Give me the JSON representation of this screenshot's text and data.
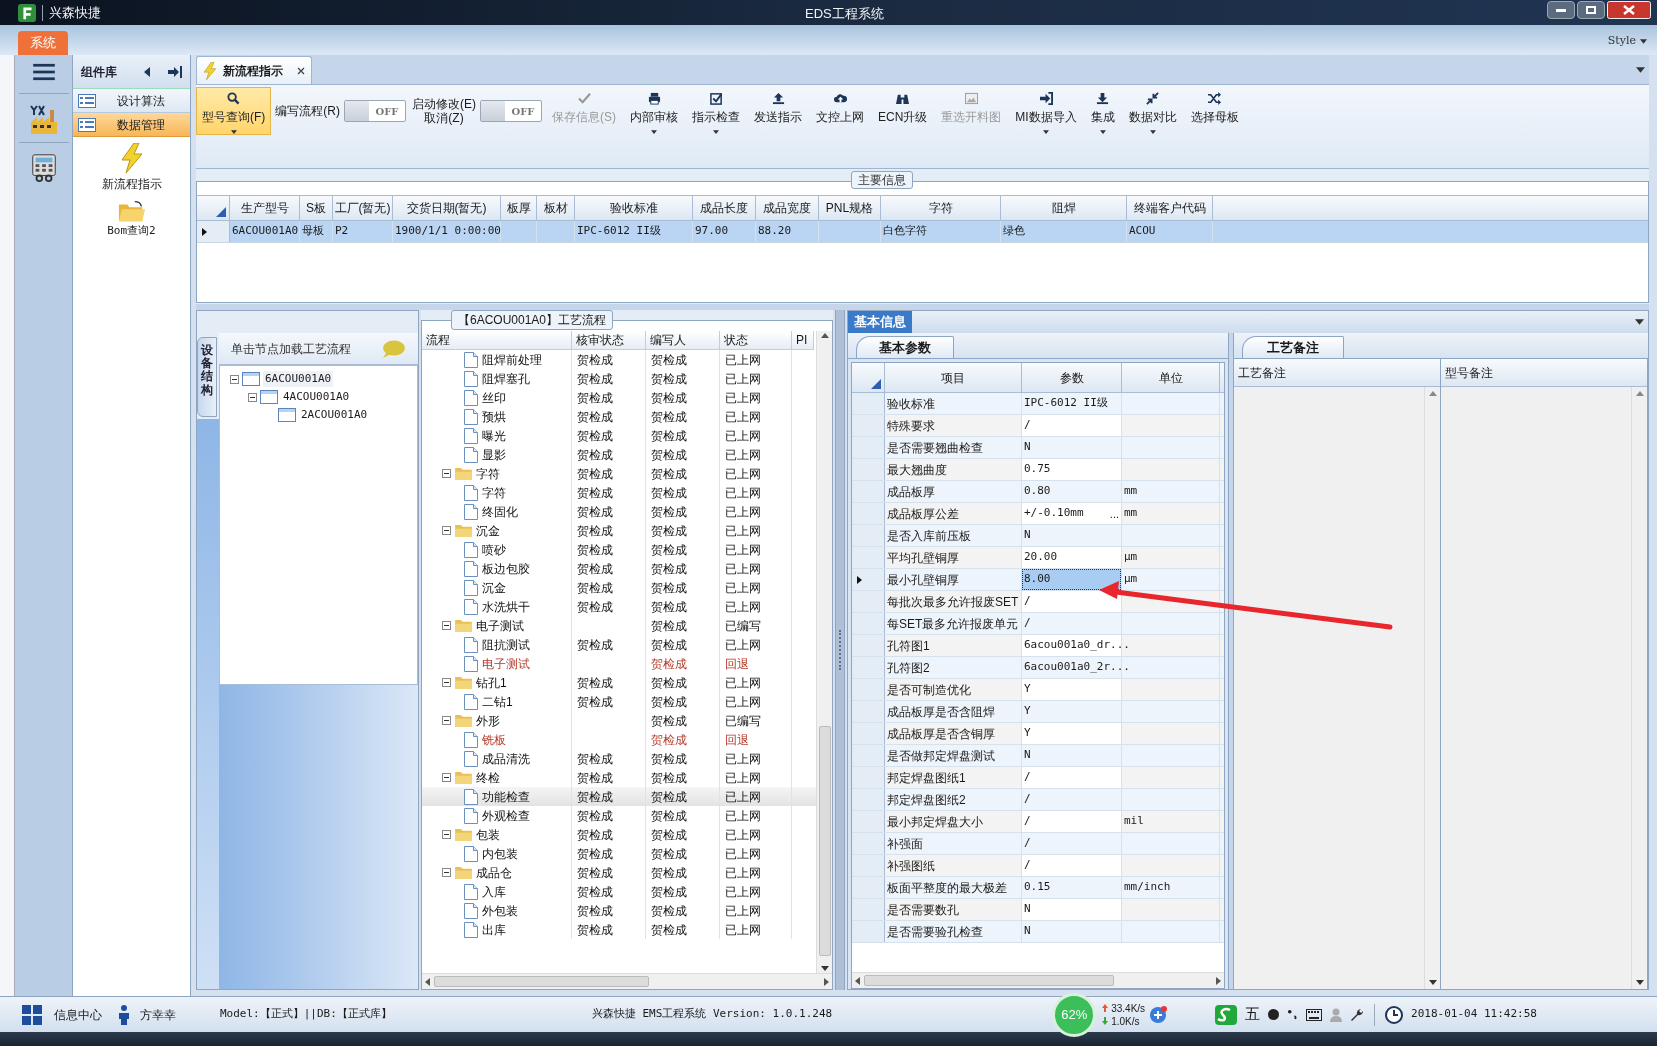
{
  "window": {
    "app_name": "兴森快捷",
    "title": "EDS工程系统"
  },
  "ribbon": {
    "tabs": [
      {
        "label": "系统",
        "selected": true
      }
    ],
    "style_button": "Style"
  },
  "component_panel": {
    "title": "组件库",
    "items": [
      {
        "label": "设计算法",
        "selected": false
      },
      {
        "label": "数据管理",
        "selected": true
      }
    ],
    "launchers": [
      {
        "label": "新流程指示"
      },
      {
        "label": "Bom查询2"
      }
    ]
  },
  "doc_tabs": [
    {
      "label": "新流程指示",
      "selected": true
    }
  ],
  "toolbar": [
    {
      "kind": "button",
      "label": "型号查询(F)",
      "dropdown": true,
      "disabled": false,
      "selected": true
    },
    {
      "kind": "toggle",
      "label_lines": [
        "编写流程(R)"
      ],
      "switch_text": "OFF",
      "on": false
    },
    {
      "kind": "toggle",
      "label_lines": [
        "启动修改(E)",
        "取消(Z)"
      ],
      "switch_text": "OFF",
      "on": false
    },
    {
      "kind": "button",
      "label": "保存信息(S)",
      "dropdown": false,
      "disabled": true,
      "selected": false
    },
    {
      "kind": "button",
      "label": "内部审核",
      "dropdown": true,
      "disabled": false,
      "selected": false
    },
    {
      "kind": "button",
      "label": "指示检查",
      "dropdown": true,
      "disabled": false,
      "selected": false
    },
    {
      "kind": "button",
      "label": "发送指示",
      "dropdown": false,
      "disabled": false,
      "selected": false
    },
    {
      "kind": "button",
      "label": "文控上网",
      "dropdown": false,
      "disabled": false,
      "selected": false
    },
    {
      "kind": "button",
      "label": "ECN升级",
      "dropdown": false,
      "disabled": false,
      "selected": false
    },
    {
      "kind": "button",
      "label": "重选开料图",
      "dropdown": false,
      "disabled": true,
      "selected": false
    },
    {
      "kind": "button",
      "label": "MI数据导入",
      "dropdown": true,
      "disabled": false,
      "selected": false
    },
    {
      "kind": "button",
      "label": "集成",
      "dropdown": true,
      "disabled": false,
      "selected": false
    },
    {
      "kind": "button",
      "label": "数据对比",
      "dropdown": true,
      "disabled": false,
      "selected": false
    },
    {
      "kind": "button",
      "label": "选择母板",
      "dropdown": false,
      "disabled": false,
      "selected": false
    }
  ],
  "main_info": {
    "title": "主要信息",
    "columns": [
      "生产型号",
      "S板",
      "工厂(暂无)",
      "交货日期(暂无)",
      "板厚",
      "板材",
      "验收标准",
      "成品长度",
      "成品宽度",
      "PNL规格",
      "字符",
      "阻焊",
      "终端客户代码"
    ],
    "rows": [
      {
        "selected": true,
        "cells": [
          "6ACOU001A0",
          "母板",
          "P2",
          "1900/1/1 0:00:00",
          null,
          null,
          "IPC-6012 II级",
          "97.00",
          "88.20",
          null,
          "白色字符",
          "绿色",
          "ACOU"
        ]
      }
    ]
  },
  "structure_panel": {
    "side_tab": "设备结构",
    "hint": "单击节点加载工艺流程",
    "tree": [
      {
        "label": "6ACOU001A0",
        "expanded": true,
        "children": [
          {
            "label": "4ACOU001A0",
            "expanded": true,
            "children": [
              {
                "label": "2ACOU001A0"
              }
            ]
          }
        ]
      }
    ]
  },
  "flow_panel": {
    "title": "【6ACOU001A0】工艺流程",
    "columns": [
      "流程",
      "核审状态",
      "编写人",
      "状态",
      "PI"
    ],
    "rows": [
      {
        "kind": "offscreen",
        "children": [
          {
            "kind": "file",
            "name": "阻焊前处理",
            "review": "贺检成",
            "writer": "贺检成",
            "state": "已上网",
            "flagged": false,
            "selected": false
          },
          {
            "kind": "file",
            "name": "阻焊塞孔",
            "review": "贺检成",
            "writer": "贺检成",
            "state": "已上网",
            "flagged": false,
            "selected": false
          },
          {
            "kind": "file",
            "name": "丝印",
            "review": "贺检成",
            "writer": "贺检成",
            "state": "已上网",
            "flagged": false,
            "selected": false
          },
          {
            "kind": "file",
            "name": "预烘",
            "review": "贺检成",
            "writer": "贺检成",
            "state": "已上网",
            "flagged": false,
            "selected": false
          },
          {
            "kind": "file",
            "name": "曝光",
            "review": "贺检成",
            "writer": "贺检成",
            "state": "已上网",
            "flagged": false,
            "selected": false
          },
          {
            "kind": "file",
            "name": "显影",
            "review": "贺检成",
            "writer": "贺检成",
            "state": "已上网",
            "flagged": false,
            "selected": false
          }
        ]
      },
      {
        "kind": "folder",
        "name": "字符",
        "review": "贺检成",
        "writer": "贺检成",
        "state": "已上网",
        "expanded": true,
        "flagged": false,
        "selected": false,
        "children": [
          {
            "kind": "file",
            "name": "字符",
            "review": "贺检成",
            "writer": "贺检成",
            "state": "已上网",
            "flagged": false,
            "selected": false
          },
          {
            "kind": "file",
            "name": "终固化",
            "review": "贺检成",
            "writer": "贺检成",
            "state": "已上网",
            "flagged": false,
            "selected": false
          }
        ]
      },
      {
        "kind": "folder",
        "name": "沉金",
        "review": "贺检成",
        "writer": "贺检成",
        "state": "已上网",
        "expanded": true,
        "flagged": false,
        "selected": false,
        "children": [
          {
            "kind": "file",
            "name": "喷砂",
            "review": "贺检成",
            "writer": "贺检成",
            "state": "已上网",
            "flagged": false,
            "selected": false
          },
          {
            "kind": "file",
            "name": "板边包胶",
            "review": "贺检成",
            "writer": "贺检成",
            "state": "已上网",
            "flagged": false,
            "selected": false
          },
          {
            "kind": "file",
            "name": "沉金",
            "review": "贺检成",
            "writer": "贺检成",
            "state": "已上网",
            "flagged": false,
            "selected": false
          },
          {
            "kind": "file",
            "name": "水洗烘干",
            "review": "贺检成",
            "writer": "贺检成",
            "state": "已上网",
            "flagged": false,
            "selected": false
          }
        ]
      },
      {
        "kind": "folder",
        "name": "电子测试",
        "writer": "贺检成",
        "state": "已编写",
        "expanded": true,
        "flagged": false,
        "selected": false,
        "children": [
          {
            "kind": "file",
            "name": "阻抗测试",
            "review": "贺检成",
            "writer": "贺检成",
            "state": "已上网",
            "flagged": false,
            "selected": false
          },
          {
            "kind": "file",
            "name": "电子测试",
            "writer": "贺检成",
            "state": "回退",
            "flagged": true,
            "selected": false
          }
        ]
      },
      {
        "kind": "folder",
        "name": "钻孔1",
        "review": "贺检成",
        "writer": "贺检成",
        "state": "已上网",
        "expanded": true,
        "flagged": false,
        "selected": false,
        "children": [
          {
            "kind": "file",
            "name": "二钻1",
            "review": "贺检成",
            "writer": "贺检成",
            "state": "已上网",
            "flagged": false,
            "selected": false
          }
        ]
      },
      {
        "kind": "folder",
        "name": "外形",
        "writer": "贺检成",
        "state": "已编写",
        "expanded": true,
        "flagged": false,
        "selected": false,
        "children": [
          {
            "kind": "file",
            "name": "铣板",
            "writer": "贺检成",
            "state": "回退",
            "flagged": true,
            "selected": false
          },
          {
            "kind": "file",
            "name": "成品清洗",
            "review": "贺检成",
            "writer": "贺检成",
            "state": "已上网",
            "flagged": false,
            "selected": false
          }
        ]
      },
      {
        "kind": "folder",
        "name": "终检",
        "review": "贺检成",
        "writer": "贺检成",
        "state": "已上网",
        "expanded": true,
        "flagged": false,
        "selected": false,
        "children": [
          {
            "kind": "file",
            "name": "功能检查",
            "review": "贺检成",
            "writer": "贺检成",
            "state": "已上网",
            "flagged": false,
            "selected": true
          },
          {
            "kind": "file",
            "name": "外观检查",
            "review": "贺检成",
            "writer": "贺检成",
            "state": "已上网",
            "flagged": false,
            "selected": false
          }
        ]
      },
      {
        "kind": "folder",
        "name": "包装",
        "review": "贺检成",
        "writer": "贺检成",
        "state": "已上网",
        "expanded": true,
        "flagged": false,
        "selected": false,
        "children": [
          {
            "kind": "file",
            "name": "内包装",
            "review": "贺检成",
            "writer": "贺检成",
            "state": "已上网",
            "flagged": false,
            "selected": false
          }
        ]
      },
      {
        "kind": "folder",
        "name": "成品仓",
        "review": "贺检成",
        "writer": "贺检成",
        "state": "已上网",
        "expanded": true,
        "flagged": false,
        "selected": false,
        "children": [
          {
            "kind": "file",
            "name": "入库",
            "review": "贺检成",
            "writer": "贺检成",
            "state": "已上网",
            "flagged": false,
            "selected": false
          },
          {
            "kind": "file",
            "name": "外包装",
            "review": "贺检成",
            "writer": "贺检成",
            "state": "已上网",
            "flagged": false,
            "selected": false
          },
          {
            "kind": "file",
            "name": "出库",
            "review": "贺检成",
            "writer": "贺检成",
            "state": "已上网",
            "flagged": false,
            "selected": false
          }
        ]
      }
    ]
  },
  "info_panel": {
    "title": "基本信息",
    "params_tab": "基本参数",
    "param_columns": [
      "项目",
      "参数",
      "单位"
    ],
    "params": [
      {
        "item": "验收标准",
        "value": "IPC-6012 II级",
        "selected": false
      },
      {
        "item": "特殊要求",
        "value": "/",
        "selected": false
      },
      {
        "item": "是否需要翘曲检查",
        "value": "N",
        "selected": false
      },
      {
        "item": "最大翘曲度",
        "value": "0.75",
        "selected": false
      },
      {
        "item": "成品板厚",
        "value": "0.80",
        "unit": "mm",
        "selected": false
      },
      {
        "item": "成品板厚公差",
        "value": "+/-0.10mm",
        "more": "...",
        "unit": "mm",
        "selected": false
      },
      {
        "item": "是否入库前压板",
        "value": "N",
        "selected": false
      },
      {
        "item": "平均孔壁铜厚",
        "value": "20.00",
        "unit": "μm",
        "selected": false
      },
      {
        "item": "最小孔壁铜厚",
        "value": "8.00",
        "unit": "μm",
        "selected": true
      },
      {
        "item": "每批次最多允许报废SET",
        "value": "/",
        "selected": false
      },
      {
        "item": "每SET最多允许报废单元",
        "value": "/",
        "selected": false
      },
      {
        "item": "孔符图1",
        "value": "6acou001a0_dr...",
        "selected": false
      },
      {
        "item": "孔符图2",
        "value": "6acou001a0_2r...",
        "selected": false
      },
      {
        "item": "是否可制造优化",
        "value": "Y",
        "selected": false
      },
      {
        "item": "成品板厚是否含阻焊",
        "value": "Y",
        "selected": false
      },
      {
        "item": "成品板厚是否含铜厚",
        "value": "Y",
        "selected": false
      },
      {
        "item": "是否做邦定焊盘测试",
        "value": "N",
        "selected": false
      },
      {
        "item": "邦定焊盘图纸1",
        "value": "/",
        "selected": false
      },
      {
        "item": "邦定焊盘图纸2",
        "value": "/",
        "selected": false
      },
      {
        "item": "最小邦定焊盘大小",
        "value": "/",
        "unit": "mil",
        "selected": false
      },
      {
        "item": "补强面",
        "value": "/",
        "selected": false
      },
      {
        "item": "补强图纸",
        "value": "/",
        "selected": false
      },
      {
        "item": "板面平整度的最大极差",
        "value": "0.15",
        "unit": "mm/inch",
        "selected": false
      },
      {
        "item": "是否需要数孔",
        "value": "N",
        "selected": false
      },
      {
        "item": "是否需要验孔检查",
        "value": "N",
        "selected": false
      }
    ],
    "remarks_tab": "工艺备注",
    "remark_columns": [
      "工艺备注",
      "型号备注"
    ]
  },
  "status_bar": {
    "message_center": "信息中心",
    "user": "方幸幸",
    "model": "Model:【正式】||DB:【正式库】",
    "version": "兴森快捷 EMS工程系统 Version: 1.0.1.248",
    "memory": "62%",
    "upload_speed": "33.4K/s",
    "download_speed": "1.0K/s",
    "ime": "五",
    "clock": "2018-01-04 11:42:58"
  }
}
